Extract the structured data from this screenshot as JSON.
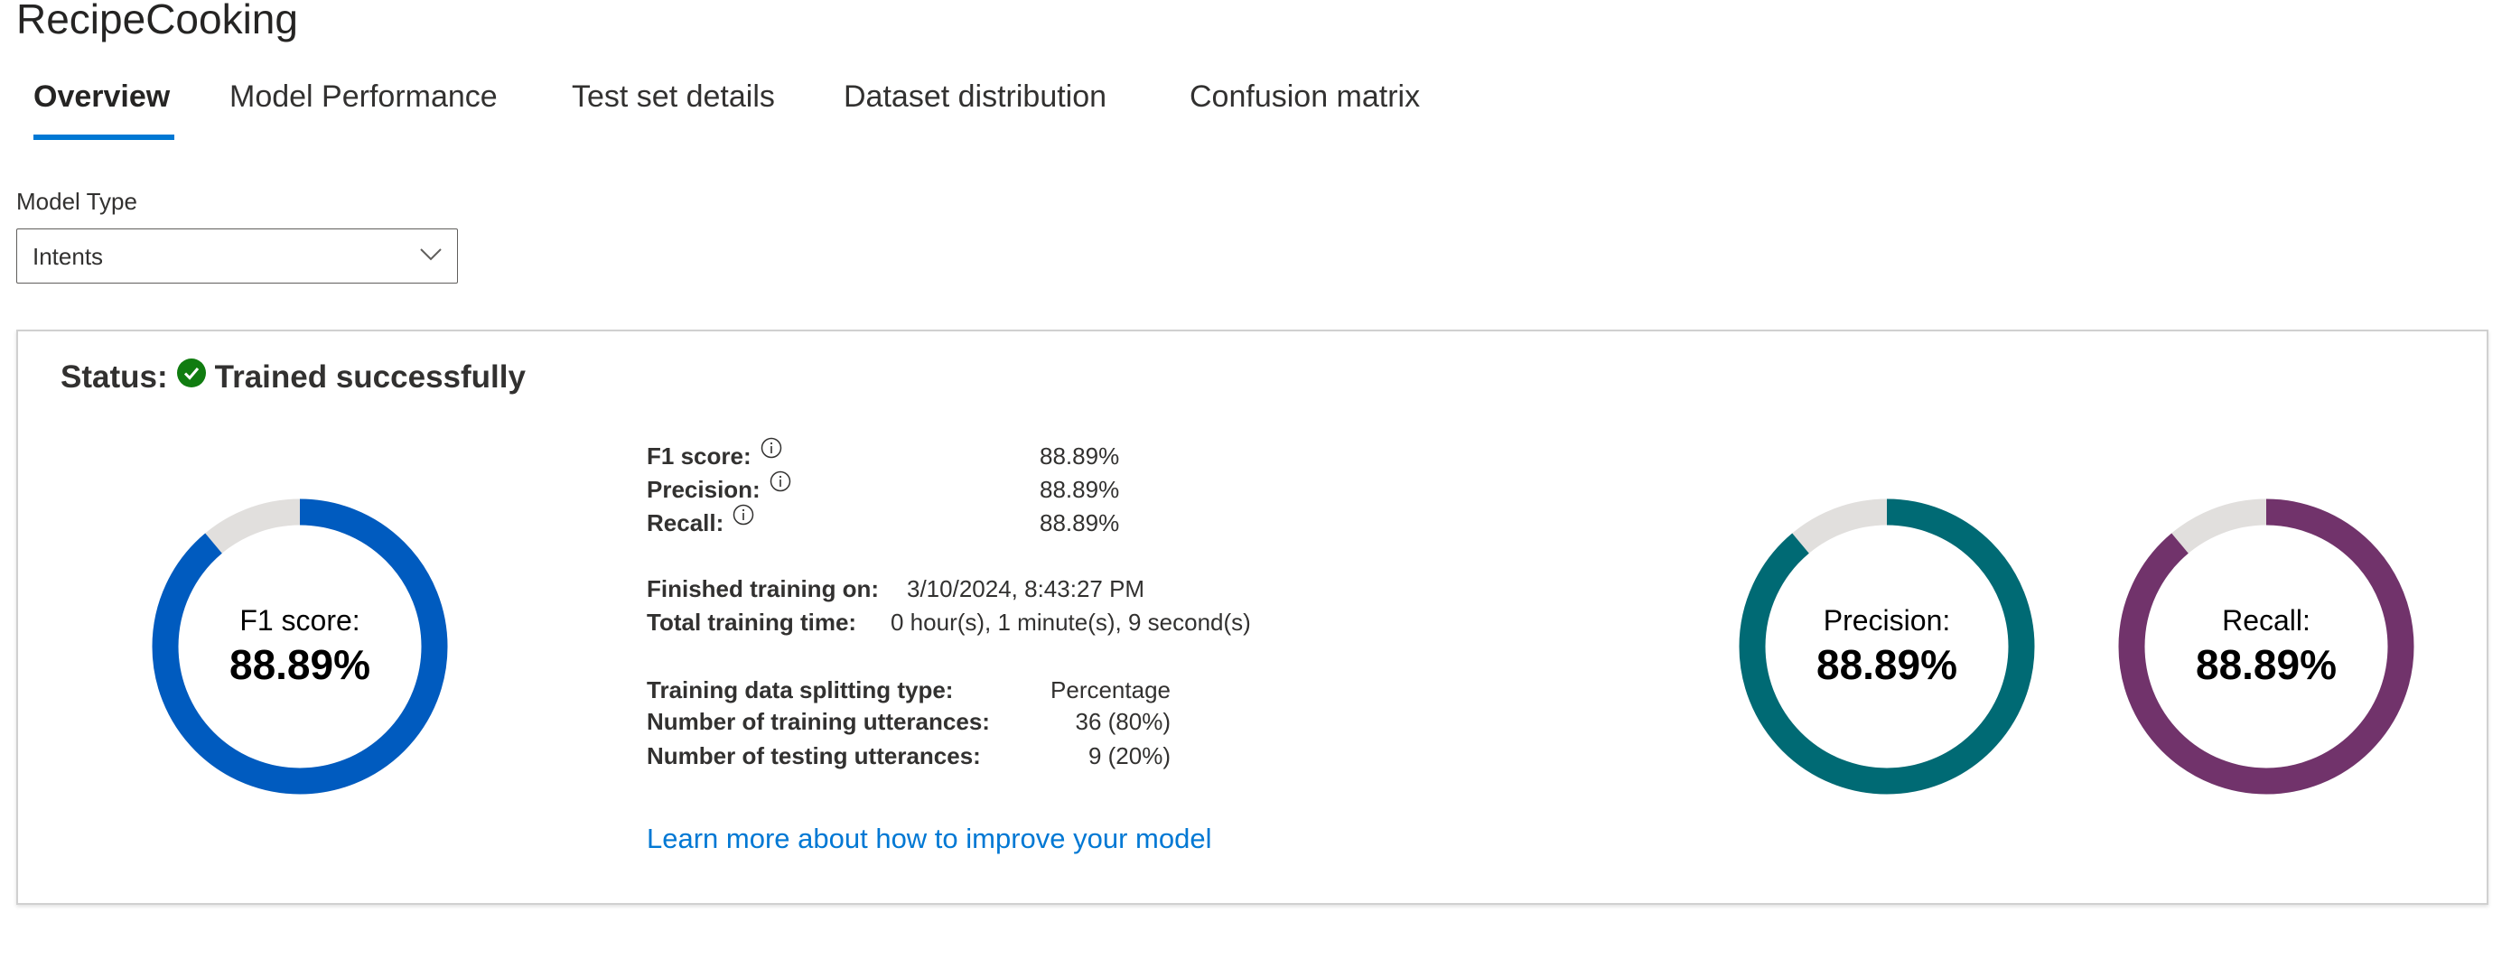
{
  "header": {
    "title": "RecipeCooking"
  },
  "tabs": [
    {
      "label": "Overview",
      "active": true
    },
    {
      "label": "Model Performance"
    },
    {
      "label": "Test set details"
    },
    {
      "label": "Dataset distribution"
    },
    {
      "label": "Confusion matrix"
    }
  ],
  "model_type": {
    "label": "Model Type",
    "selected": "Intents"
  },
  "status": {
    "label": "Status:",
    "value": "Trained successfully",
    "color": "#107c10"
  },
  "donuts": [
    {
      "label": "F1 score:",
      "value_text": "88.89%",
      "value": 88.89,
      "color": "#005bbf"
    },
    {
      "label": "Precision:",
      "value_text": "88.89%",
      "value": 88.89,
      "color": "#006a74"
    },
    {
      "label": "Recall:",
      "value_text": "88.89%",
      "value": 88.89,
      "color": "#71336b"
    }
  ],
  "remaining_color": "#e1dfdd",
  "metrics": [
    {
      "label": "F1 score:",
      "value": "88.89%"
    },
    {
      "label": "Precision:",
      "value": "88.89%"
    },
    {
      "label": "Recall:",
      "value": "88.89%"
    }
  ],
  "training": {
    "finished_label": "Finished training on:",
    "finished_value": "3/10/2024, 8:43:27 PM",
    "time_label": "Total training time:",
    "time_value": "0 hour(s), 1 minute(s), 9 second(s)"
  },
  "split": {
    "type_label": "Training data splitting type:",
    "type_value": "Percentage",
    "train_label": "Number of training utterances:",
    "train_value": "36 (80%)",
    "test_label": "Number of testing utterances:",
    "test_value": "9 (20%)"
  },
  "learn_more": "Learn more about how to improve your model"
}
